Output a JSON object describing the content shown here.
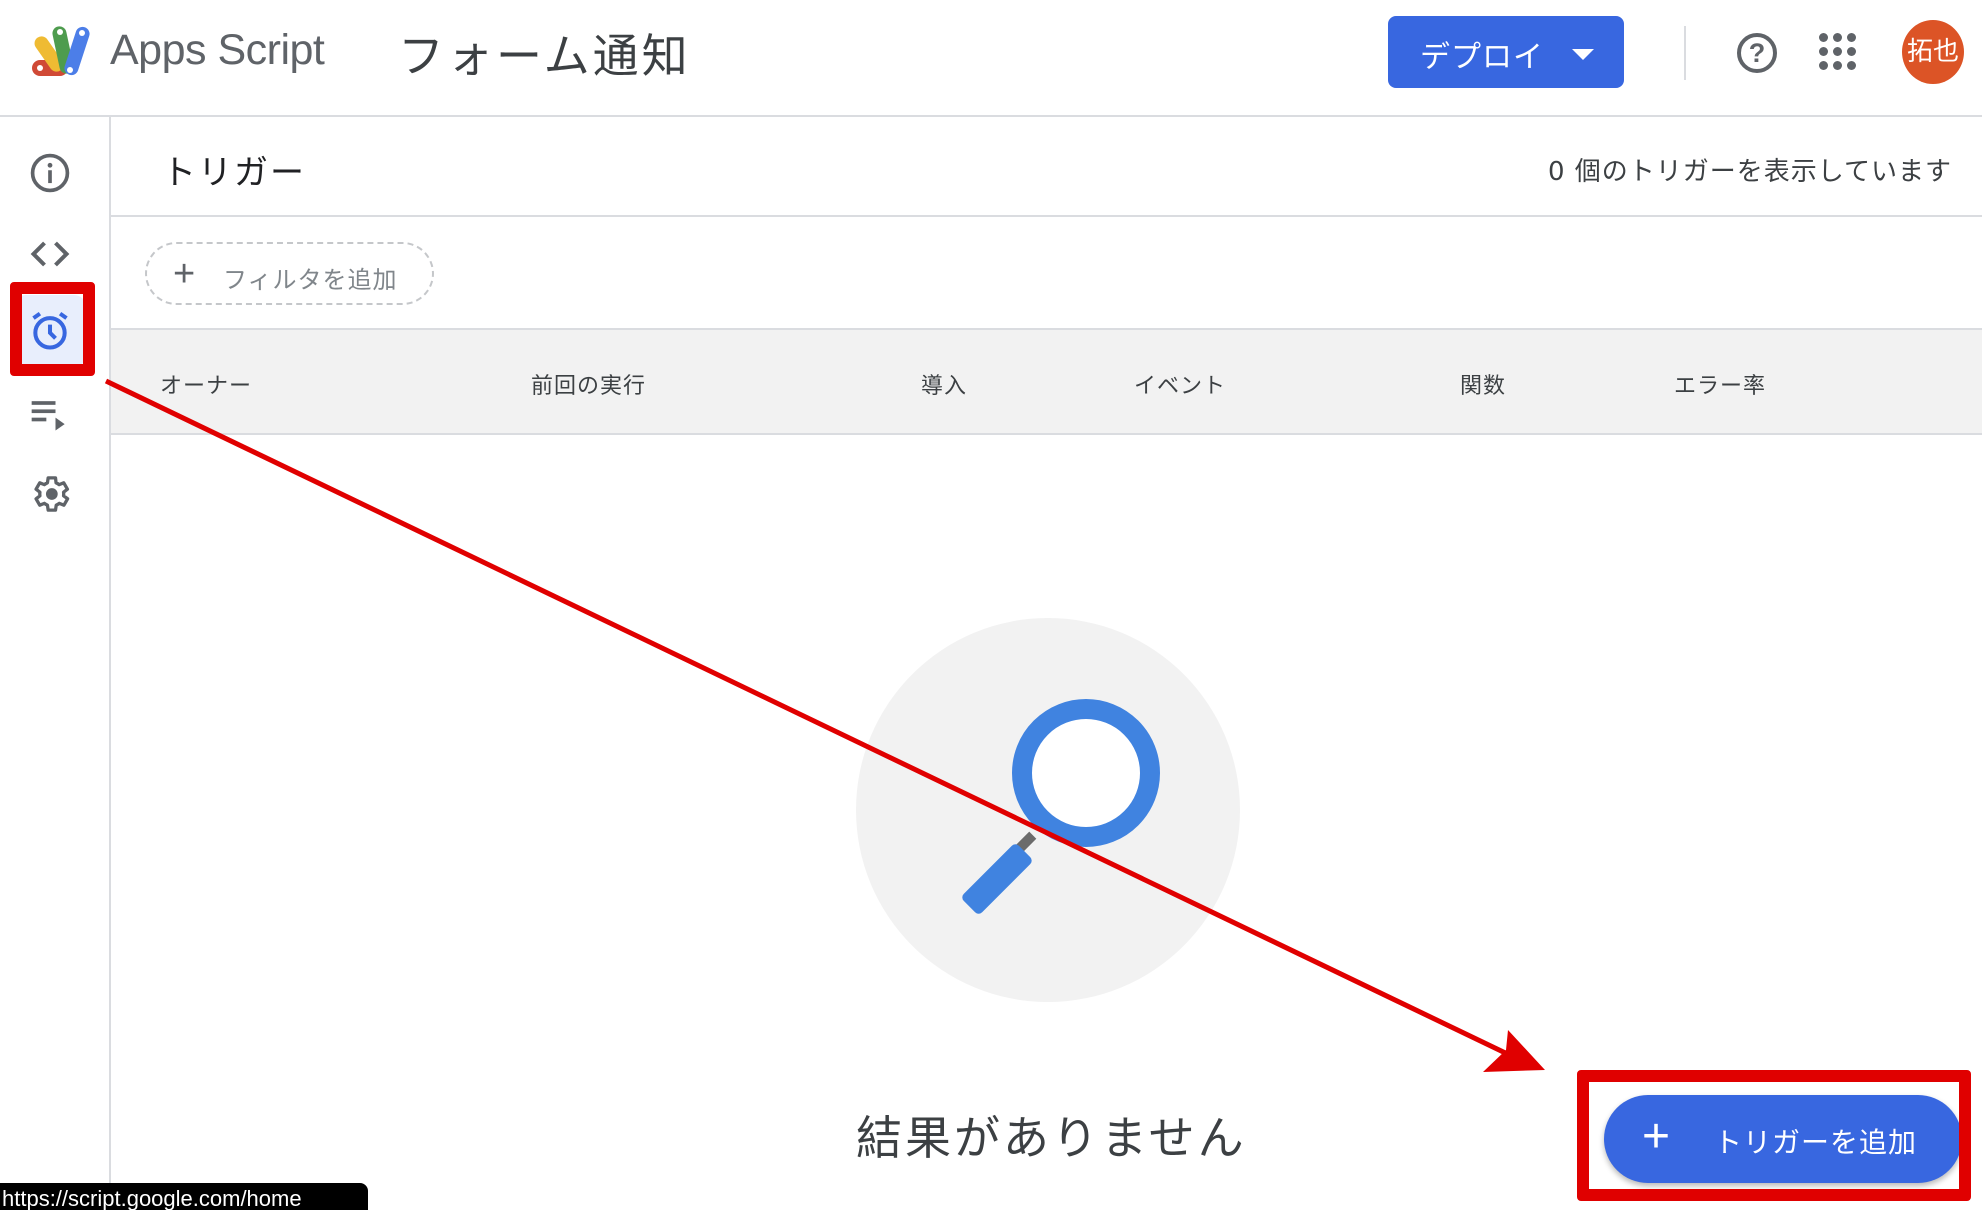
{
  "header": {
    "brand": "Apps Script",
    "project_title": "フォーム通知",
    "deploy_label": "デプロイ",
    "help_icon": "help-circle-icon",
    "apps_icon": "apps-grid-icon",
    "avatar_text": "拓也",
    "avatar_color": "#dc5426"
  },
  "sidebar": {
    "items": [
      {
        "id": "overview",
        "icon": "info-icon",
        "active": false
      },
      {
        "id": "editor",
        "icon": "code-icon",
        "active": false
      },
      {
        "id": "triggers",
        "icon": "alarm-clock-icon",
        "active": true
      },
      {
        "id": "executions",
        "icon": "playlist-play-icon",
        "active": false
      },
      {
        "id": "settings",
        "icon": "gear-icon",
        "active": false
      }
    ]
  },
  "main": {
    "title": "トリガー",
    "count_text": "0 個のトリガーを表示しています",
    "filter_label": "フィルタを追加",
    "columns": [
      "オーナー",
      "前回の実行",
      "導入",
      "イベント",
      "関数",
      "エラー率"
    ],
    "empty_text": "結果がありません",
    "add_trigger_label": "トリガーを追加"
  },
  "status_tooltip": "https://script.google.com/home",
  "colors": {
    "accent": "#3867e0",
    "annotation": "#e00000",
    "magnifier": "#4083e0"
  }
}
